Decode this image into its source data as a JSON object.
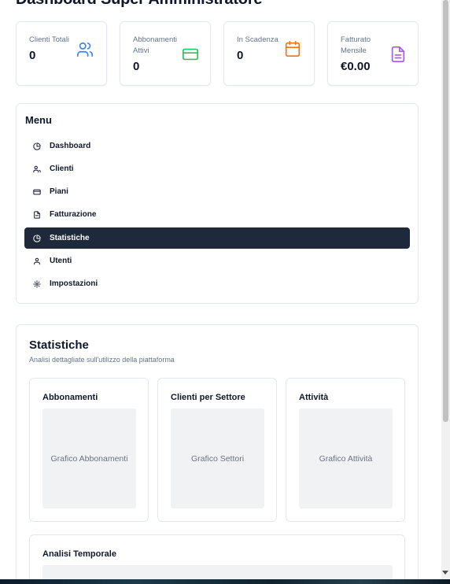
{
  "header": {
    "title": "Dashboard Super Amministratore"
  },
  "stats": [
    {
      "label": "Clienti Totali",
      "value": "0",
      "icon": "users-icon",
      "color": "#3b82f6"
    },
    {
      "label": "Abbonamenti Attivi",
      "value": "0",
      "icon": "credit-card-icon",
      "color": "#22c55e"
    },
    {
      "label": "In Scadenza",
      "value": "0",
      "icon": "calendar-icon",
      "color": "#f97316"
    },
    {
      "label": "Fatturato Mensile",
      "value": "€0.00",
      "icon": "file-text-icon",
      "color": "#a855f7"
    }
  ],
  "menu": {
    "title": "Menu",
    "active_color": "#1e293b",
    "items": [
      {
        "label": "Dashboard",
        "icon": "pie-chart-icon"
      },
      {
        "label": "Clienti",
        "icon": "users-icon"
      },
      {
        "label": "Piani",
        "icon": "credit-card-icon"
      },
      {
        "label": "Fatturazione",
        "icon": "file-text-icon"
      },
      {
        "label": "Statistiche",
        "icon": "pie-chart-icon",
        "active": true
      },
      {
        "label": "Utenti",
        "icon": "user-icon"
      },
      {
        "label": "Impostazioni",
        "icon": "gear-icon"
      }
    ]
  },
  "statistics": {
    "title": "Statistiche",
    "subtitle": "Analisi dettagliate sull'utilizzo della piattaforma",
    "charts": [
      {
        "title": "Abbonamenti",
        "placeholder": "Grafico Abbonamenti"
      },
      {
        "title": "Clienti per Settore",
        "placeholder": "Grafico Settori"
      },
      {
        "title": "Attività",
        "placeholder": "Grafico Attività"
      }
    ],
    "timeline": {
      "title": "Analisi Temporale"
    }
  }
}
